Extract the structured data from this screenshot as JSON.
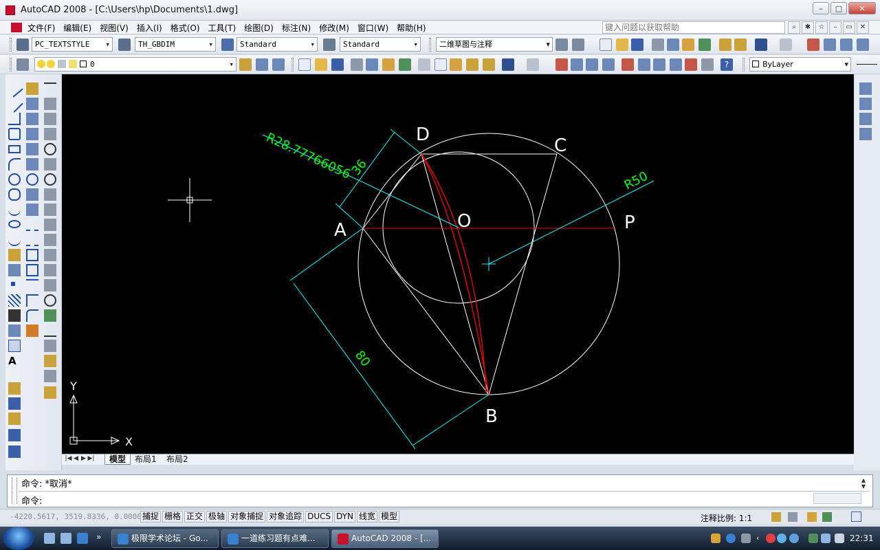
{
  "window": {
    "title": "AutoCAD 2008 - [C:\\Users\\hp\\Documents\\1.dwg]"
  },
  "menu": {
    "items": [
      "文件(F)",
      "编辑(E)",
      "视图(V)",
      "插入(I)",
      "格式(O)",
      "工具(T)",
      "绘图(D)",
      "标注(N)",
      "修改(M)",
      "窗口(W)",
      "帮助(H)"
    ],
    "help_placeholder": "键入问题以获取帮助"
  },
  "toolbar1": {
    "text_style": "PC_TEXTSTYLE",
    "dim_style": "TH_GBDIM",
    "table_style": "Standard",
    "multileader_style": "Standard",
    "workspace": "二维草图与注释"
  },
  "toolbar2": {
    "layer": "0",
    "linetype": "ByLayer"
  },
  "drawing": {
    "point_labels": [
      "D",
      "C",
      "A",
      "O",
      "P",
      "B"
    ],
    "dimension_labels": [
      "R28.77766056",
      "36",
      "R50",
      "80"
    ],
    "ucs_labels": [
      "Y",
      "X"
    ],
    "colors": {
      "geometry": "#ffffff",
      "dimension": "#00ffff",
      "dim_text": "#00ff00",
      "highlight": "#ff0000",
      "background": "#000000"
    }
  },
  "layout_tabs": [
    "模型",
    "布局1",
    "布局2"
  ],
  "command": {
    "history": "命令: *取消*",
    "prompt": "命令:"
  },
  "status": {
    "coords": "-4220.5617, 3519.8336, 0.0000",
    "toggles": [
      "捕捉",
      "栅格",
      "正交",
      "极轴",
      "对象捕捉",
      "对象追踪",
      "DUCS",
      "DYN",
      "线宽",
      "模型"
    ],
    "annotation_scale": "注释比例: 1:1"
  },
  "taskbar": {
    "tasks": [
      "极限学术论坛 - Go...",
      "一道练习题有点难...",
      "AutoCAD 2008 - [..."
    ],
    "clock": "22:31"
  }
}
